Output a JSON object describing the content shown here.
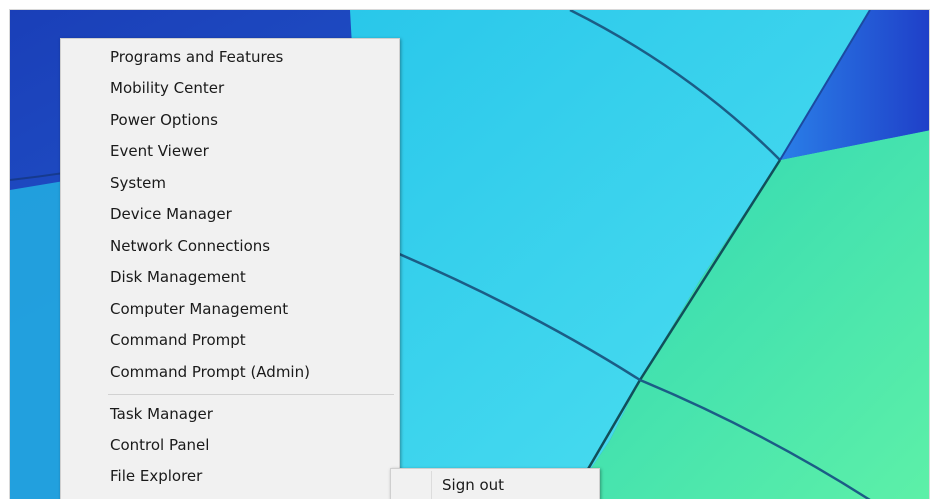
{
  "menu": {
    "items": [
      {
        "label": "Programs and Features"
      },
      {
        "label": "Mobility Center"
      },
      {
        "label": "Power Options"
      },
      {
        "label": "Event Viewer"
      },
      {
        "label": "System"
      },
      {
        "label": "Device Manager"
      },
      {
        "label": "Network Connections"
      },
      {
        "label": "Disk Management"
      },
      {
        "label": "Computer Management"
      },
      {
        "label": "Command Prompt"
      },
      {
        "label": "Command Prompt (Admin)"
      },
      {
        "label": "Task Manager"
      },
      {
        "label": "Control Panel"
      },
      {
        "label": "File Explorer"
      }
    ]
  },
  "submenu": {
    "items": [
      {
        "label": "Sign out"
      }
    ]
  },
  "colors": {
    "menu_background": "#f1f1f1",
    "wallpaper_blue": "#1a4fc9",
    "wallpaper_cyan": "#35d4e8",
    "wallpaper_green": "#3de0a6"
  }
}
